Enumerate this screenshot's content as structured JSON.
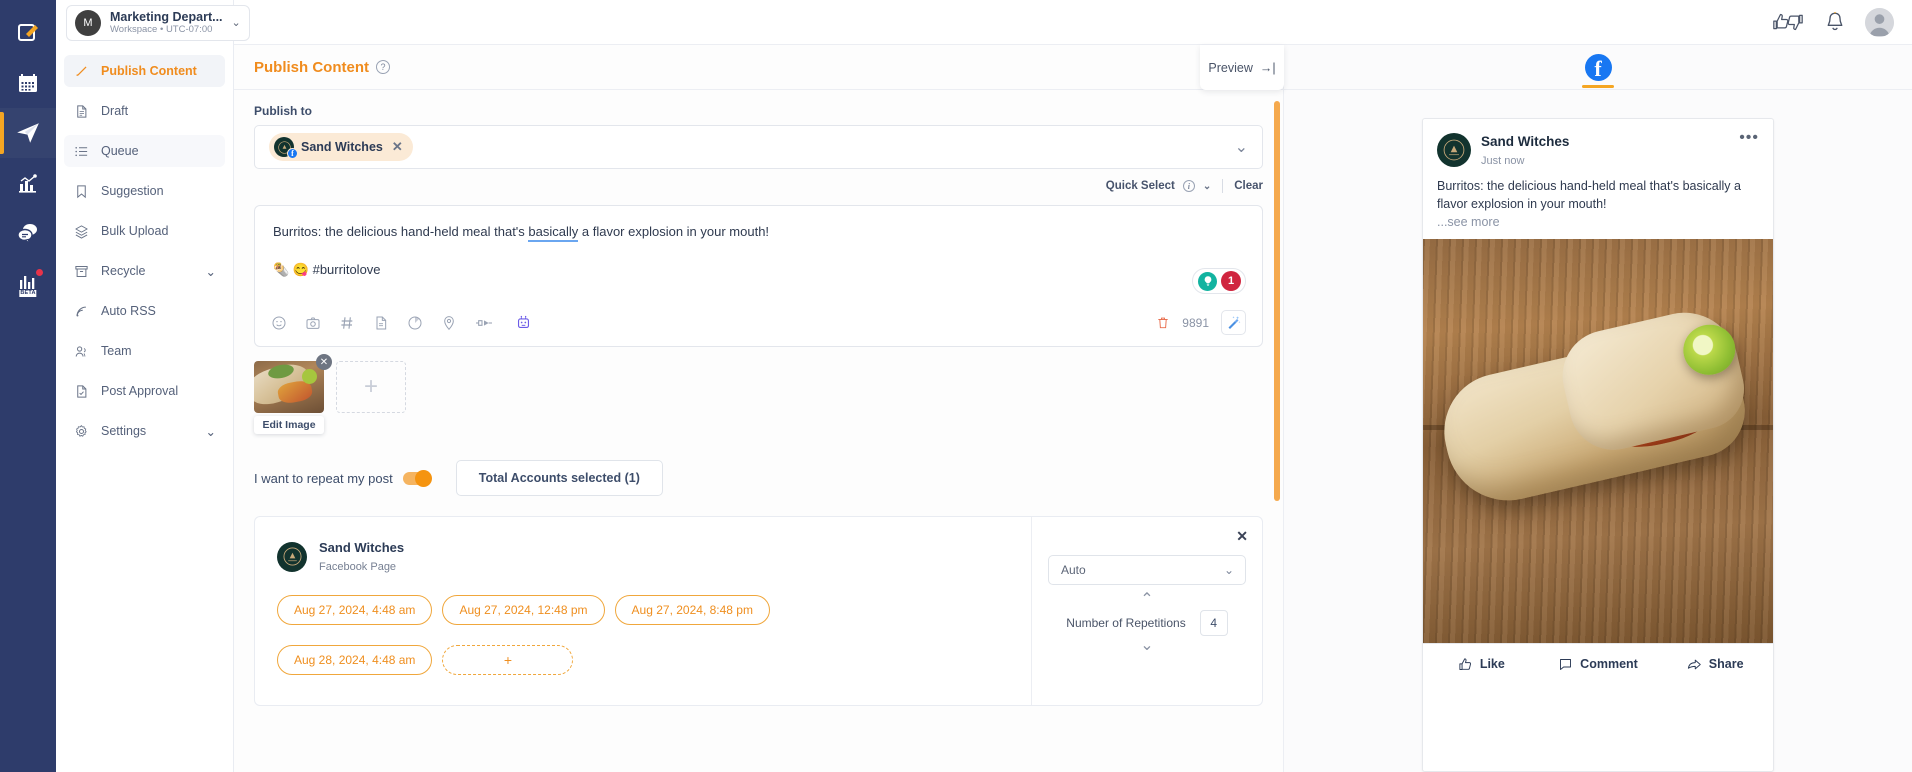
{
  "rail": {
    "items": [
      {
        "name": "compose-icon",
        "label": "Compose",
        "active": false,
        "badge": false
      },
      {
        "name": "calendar-icon",
        "label": "Calendar",
        "active": false,
        "badge": false
      },
      {
        "name": "publish-paper-plane-icon",
        "label": "Publish",
        "active": true,
        "badge": false
      },
      {
        "name": "analytics-icon",
        "label": "Analytics",
        "active": false,
        "badge": false
      },
      {
        "name": "inbox-chat-icon",
        "label": "Inbox",
        "active": false,
        "badge": false
      },
      {
        "name": "reports-beta-icon",
        "label": "Reports",
        "active": false,
        "badge": true,
        "tag": "BETA"
      }
    ]
  },
  "workspace": {
    "avatar_initial": "M",
    "name": "Marketing Depart...",
    "subtitle": "Workspace • UTC-07:00"
  },
  "sidebar": {
    "items": [
      {
        "label": "Publish Content",
        "icon": "pencil-icon",
        "active": true,
        "chevron": false
      },
      {
        "label": "Draft",
        "icon": "document-icon",
        "active": false,
        "chevron": false
      },
      {
        "label": "Queue",
        "icon": "list-icon",
        "active": false,
        "chevron": false
      },
      {
        "label": "Suggestion",
        "icon": "bookmark-icon",
        "active": false,
        "chevron": false
      },
      {
        "label": "Bulk Upload",
        "icon": "layers-icon",
        "active": false,
        "chevron": false
      },
      {
        "label": "Recycle",
        "icon": "archive-icon",
        "active": false,
        "chevron": true
      },
      {
        "label": "Auto RSS",
        "icon": "rss-icon",
        "active": false,
        "chevron": false
      },
      {
        "label": "Team",
        "icon": "users-icon",
        "active": false,
        "chevron": false
      },
      {
        "label": "Post Approval",
        "icon": "document-check-icon",
        "active": false,
        "chevron": false
      },
      {
        "label": "Settings",
        "icon": "gear-icon",
        "active": false,
        "chevron": true
      }
    ]
  },
  "topbar": {
    "thumbs_label": "Feedback",
    "bell_label": "Notifications",
    "avatar_label": "Account"
  },
  "editor": {
    "title": "Publish Content",
    "help_glyph": "?",
    "publish_to_label": "Publish to",
    "selected_accounts": [
      {
        "name": "Sand Witches",
        "network": "facebook",
        "remove_glyph": "✕"
      }
    ],
    "quick_select_label": "Quick Select",
    "quick_select_info": "i",
    "clear_label": "Clear",
    "compose": {
      "line1_before": "Burritos: the delicious hand-held meal that's ",
      "line1_spell": "basically",
      "line1_after": " a flavor explosion in your mouth!",
      "line2": "🌯 😋 #burritolove",
      "suggestion_count": "1",
      "char_count": "9891",
      "tools": [
        {
          "name": "emoji-icon",
          "label": "Emoji"
        },
        {
          "name": "camera-icon",
          "label": "Media"
        },
        {
          "name": "hashtag-icon",
          "label": "Hashtag"
        },
        {
          "name": "document-icon",
          "label": "Template"
        },
        {
          "name": "pie-chart-icon",
          "label": "Poll"
        },
        {
          "name": "location-pin-icon",
          "label": "Location"
        },
        {
          "name": "link-plug-icon",
          "label": "Shorten Link"
        },
        {
          "name": "ai-robot-icon",
          "label": "AI Assistant"
        }
      ],
      "delete_label": "Delete",
      "wand_label": "AI Rewrite"
    },
    "media": {
      "edit_image_label": "Edit Image",
      "remove_glyph": "✕",
      "add_glyph": "+"
    },
    "repeat": {
      "toggle_label": "I want to repeat my post",
      "toggle_on": true,
      "accounts_button": "Total Accounts selected (1)",
      "panel": {
        "account_name": "Sand Witches",
        "account_type": "Facebook Page",
        "close_glyph": "✕",
        "dates": [
          "Aug 27, 2024, 4:48 am",
          "Aug 27, 2024, 12:48 pm",
          "Aug 27, 2024, 8:48 pm",
          "Aug 28, 2024, 4:48 am"
        ],
        "add_date_glyph": "+",
        "mode_select": "Auto",
        "repetitions_label": "Number of Repetitions",
        "repetitions_value": "4",
        "up_glyph": "⌃",
        "down_glyph": "⌄"
      }
    }
  },
  "preview": {
    "tab_label": "Preview",
    "tab_arrow": "→|",
    "network_tab": "facebook",
    "post": {
      "author": "Sand Witches",
      "time": "Just now",
      "menu_glyph": "•••",
      "text": "Burritos: the delicious hand-held meal that's basically a flavor explosion in your mouth!",
      "see_more": "...see more",
      "actions": [
        {
          "label": "Like",
          "icon": "thumbs-up-icon"
        },
        {
          "label": "Comment",
          "icon": "comment-bubble-icon"
        },
        {
          "label": "Share",
          "icon": "share-arrow-icon"
        }
      ]
    }
  },
  "colors": {
    "accent": "#f08c1e",
    "rail_bg": "#2e3c6b",
    "facebook": "#1877f2",
    "badge_red": "#d0253f",
    "teal": "#12b3a0"
  }
}
